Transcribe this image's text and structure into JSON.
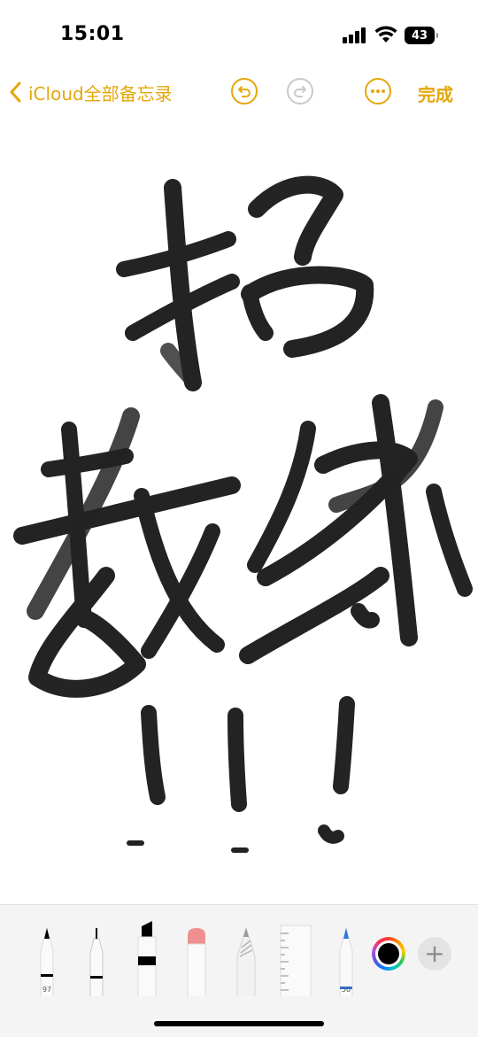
{
  "status": {
    "time": "15:01",
    "battery": "43"
  },
  "nav": {
    "back_label": "iCloud全部备忘录",
    "done_label": "完成"
  },
  "toolbar": {
    "tools": [
      {
        "name": "pen",
        "label": "97"
      },
      {
        "name": "fineliner",
        "label": ""
      },
      {
        "name": "marker",
        "label": ""
      },
      {
        "name": "eraser",
        "label": ""
      },
      {
        "name": "pencil",
        "label": ""
      },
      {
        "name": "ruler",
        "label": ""
      },
      {
        "name": "blue-pen",
        "label": "50"
      }
    ],
    "selected_color": "#000000"
  },
  "colors": {
    "accent": "#e3a70b",
    "ink": "#111111"
  }
}
